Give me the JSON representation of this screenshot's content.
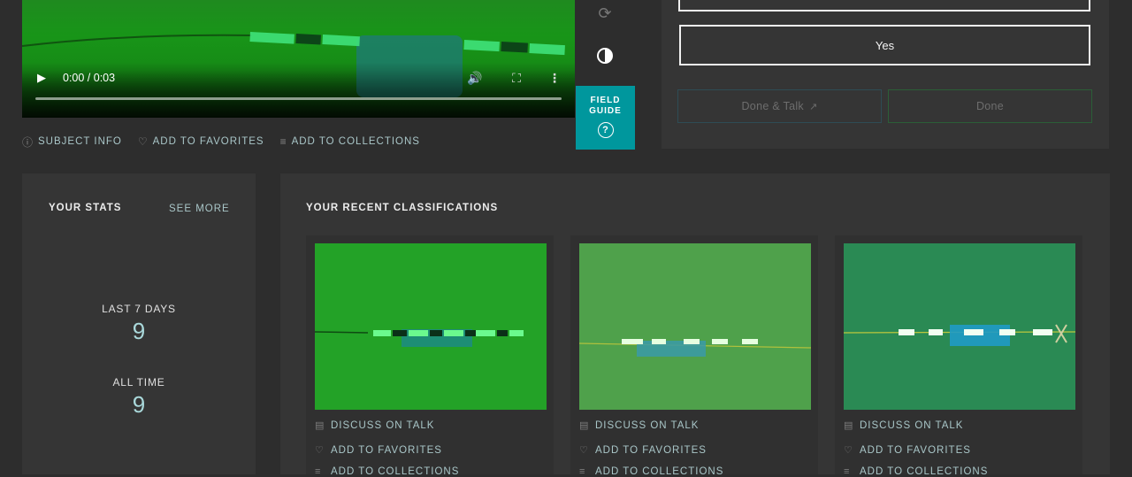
{
  "video": {
    "time": "0:00 / 0:03",
    "play_icon": "play-icon",
    "volume_icon": "volume-icon",
    "fullscreen_icon": "fullscreen-icon",
    "more_icon": "more-vertical-icon"
  },
  "tools": {
    "rotate_icon": "rotate-icon",
    "invert_icon": "invert-icon",
    "field_guide_line1": "FIELD",
    "field_guide_line2": "GUIDE",
    "field_guide_help": "?"
  },
  "subject_actions": {
    "info": "SUBJECT INFO",
    "favorites": "ADD TO FAVORITES",
    "collections": "ADD TO COLLECTIONS"
  },
  "task": {
    "answer_yes": "Yes",
    "done_talk": "Done & Talk",
    "done": "Done"
  },
  "stats": {
    "title": "YOUR STATS",
    "see_more": "SEE MORE",
    "last7_label": "LAST 7 DAYS",
    "last7_value": "9",
    "all_time_label": "ALL TIME",
    "all_time_value": "9"
  },
  "recent": {
    "title": "YOUR RECENT CLASSIFICATIONS",
    "items": [
      {
        "discuss": "DISCUSS ON TALK",
        "favorites": "ADD TO FAVORITES",
        "collections": "ADD TO COLLECTIONS"
      },
      {
        "discuss": "DISCUSS ON TALK",
        "favorites": "ADD TO FAVORITES",
        "collections": "ADD TO COLLECTIONS"
      },
      {
        "discuss": "DISCUSS ON TALK",
        "favorites": "ADD TO FAVORITES",
        "collections": "ADD TO COLLECTIONS"
      }
    ]
  },
  "colors": {
    "accent_teal": "#00979d",
    "link": "#a9c6c8",
    "panel": "#353535",
    "page": "#2d2d2d"
  }
}
